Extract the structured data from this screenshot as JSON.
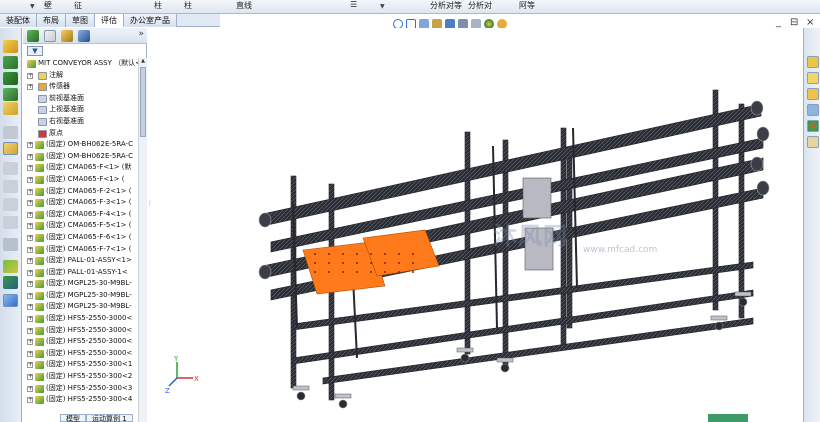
{
  "ribbon": {
    "items": [
      "壁",
      "征",
      "柱",
      "柱",
      "直线",
      "分析对等",
      "分析对",
      "阿等"
    ]
  },
  "tabs": [
    {
      "label": "装配体",
      "active": false
    },
    {
      "label": "布局",
      "active": false
    },
    {
      "label": "草图",
      "active": false
    },
    {
      "label": "评估",
      "active": true
    },
    {
      "label": "办公室产品",
      "active": false
    }
  ],
  "window_controls": {
    "minimize": "_",
    "restore": "⊟",
    "close": "×"
  },
  "panel": {
    "collapse_chevron": "»",
    "filter_glyph": "▼"
  },
  "tree": {
    "root": {
      "label": "MIT CONVEYOR ASSY （默认<"
    },
    "features": [
      {
        "label": "注解",
        "icon": "annotation-icon"
      },
      {
        "label": "传感器",
        "icon": "sensor-icon"
      },
      {
        "label": "前视基准面",
        "icon": "plane-icon"
      },
      {
        "label": "上视基准面",
        "icon": "plane-icon"
      },
      {
        "label": "右视基准面",
        "icon": "plane-icon"
      },
      {
        "label": "原点",
        "icon": "origin-icon"
      }
    ],
    "parts": [
      "(固定) OM-BH062E-5RA-C",
      "(固定) OM-BH062E-5RA-C",
      "(固定) CMA065-F<1> (默",
      "(固定) CMA065-F<1> (",
      "(固定) CMA065-F-2<1> (",
      "(固定) CMA065-F-3<1> (",
      "(固定) CMA065-F-4<1> (",
      "(固定) CMA065-F-5<1> (",
      "(固定) CMA065-F-6<1> (",
      "(固定) CMA065-F-7<1> (",
      "(固定) PALL-01-ASSY<1>",
      "(固定) PALL-01-ASSY-1<",
      "(固定) MGPL25-30-M9BL-",
      "(固定) MGPL25-30-M9BL-",
      "(固定) MGPL25-30-M9BL-",
      "(固定) HFS5-2550-3000<",
      "(固定) HFS5-2550-3000<",
      "(固定) HFS5-2550-3000<",
      "(固定) HFS5-2550-3000<",
      "(固定) HFS5-2550-300<1",
      "(固定) HFS5-2550-300<2",
      "(固定) HFS5-2550-300<3",
      "(固定) HFS5-2550-300<4"
    ]
  },
  "bottom_tabs": [
    {
      "label": "模型"
    },
    {
      "label": "运动算例 1"
    }
  ],
  "triad": {
    "x": "X",
    "y": "Y",
    "z": "Z"
  },
  "watermark": {
    "main": "沐风网",
    "sub": "www.mfcad.com"
  },
  "colors": {
    "frame": "#26282e",
    "pallet": "#ff7a1a",
    "plate": "#b9b9c4",
    "accent": "#2f6fd0"
  }
}
